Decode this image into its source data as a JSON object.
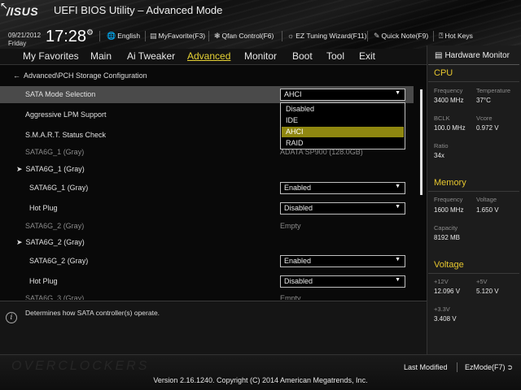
{
  "header": {
    "logo": "/ISUS",
    "title": "UEFI BIOS Utility – Advanced Mode",
    "date": "09/21/2012",
    "day": "Friday",
    "time": "17:28",
    "toolbar": {
      "language": "English",
      "myfavorite": "MyFavorite(F3)",
      "qfan": "Qfan Control(F6)",
      "ez_tuning": "EZ Tuning Wizard(F11)",
      "quick_note": "Quick Note(F9)",
      "hot_keys": "Hot Keys"
    }
  },
  "menu": {
    "items": [
      "My Favorites",
      "Main",
      "Ai Tweaker",
      "Advanced",
      "Monitor",
      "Boot",
      "Tool",
      "Exit"
    ],
    "active": "Advanced"
  },
  "breadcrumb": "Advanced\\PCH Storage Configuration",
  "settings": {
    "sata_mode_label": "SATA Mode Selection",
    "sata_mode_value": "AHCI",
    "lpm_label": "Aggressive LPM Support",
    "smart_label": "S.M.A.R.T. Status Check",
    "sata1_info_label": "SATA6G_1 (Gray)",
    "sata1_info_value": "ADATA SP900 (128.0GB)",
    "sata1_group_label": "SATA6G_1 (Gray)",
    "sata1_sub_label": "SATA6G_1 (Gray)",
    "sata1_sub_value": "Enabled",
    "sata1_hotplug_label": "Hot Plug",
    "sata1_hotplug_value": "Disabled",
    "sata2_info_label": "SATA6G_2 (Gray)",
    "sata2_info_value": "Empty",
    "sata2_group_label": "SATA6G_2 (Gray)",
    "sata2_sub_label": "SATA6G_2 (Gray)",
    "sata2_sub_value": "Enabled",
    "sata2_hotplug_label": "Hot Plug",
    "sata2_hotplug_value": "Disabled",
    "sata3_info_label": "SATA6G_3 (Gray)",
    "sata3_info_value": "Empty"
  },
  "dropdown_options": [
    "Disabled",
    "IDE",
    "AHCI",
    "RAID"
  ],
  "dropdown_selected": "AHCI",
  "help_text": "Determines how SATA controller(s) operate.",
  "hardware_monitor": {
    "title": "Hardware Monitor",
    "cpu": {
      "title": "CPU",
      "frequency_label": "Frequency",
      "frequency_value": "3400 MHz",
      "temperature_label": "Temperature",
      "temperature_value": "37°C",
      "bclk_label": "BCLK",
      "bclk_value": "100.0 MHz",
      "vcore_label": "Vcore",
      "vcore_value": "0.972 V",
      "ratio_label": "Ratio",
      "ratio_value": "34x"
    },
    "memory": {
      "title": "Memory",
      "frequency_label": "Frequency",
      "frequency_value": "1600 MHz",
      "voltage_label": "Voltage",
      "voltage_value": "1.650 V",
      "capacity_label": "Capacity",
      "capacity_value": "8192 MB"
    },
    "voltage": {
      "title": "Voltage",
      "v12_label": "+12V",
      "v12_value": "12.096 V",
      "v5_label": "+5V",
      "v5_value": "5.120 V",
      "v33_label": "+3.3V",
      "v33_value": "3.408 V"
    }
  },
  "footer": {
    "last_modified": "Last Modified",
    "ezmode": "EzMode(F7)",
    "version": "Version 2.16.1240. Copyright (C) 2014 American Megatrends, Inc.",
    "watermark": "OVERCLOCKERS"
  },
  "colors": {
    "accent_yellow": "#e6d235",
    "selected_option": "#8f8710",
    "row_highlight": "#4a4a4a"
  }
}
